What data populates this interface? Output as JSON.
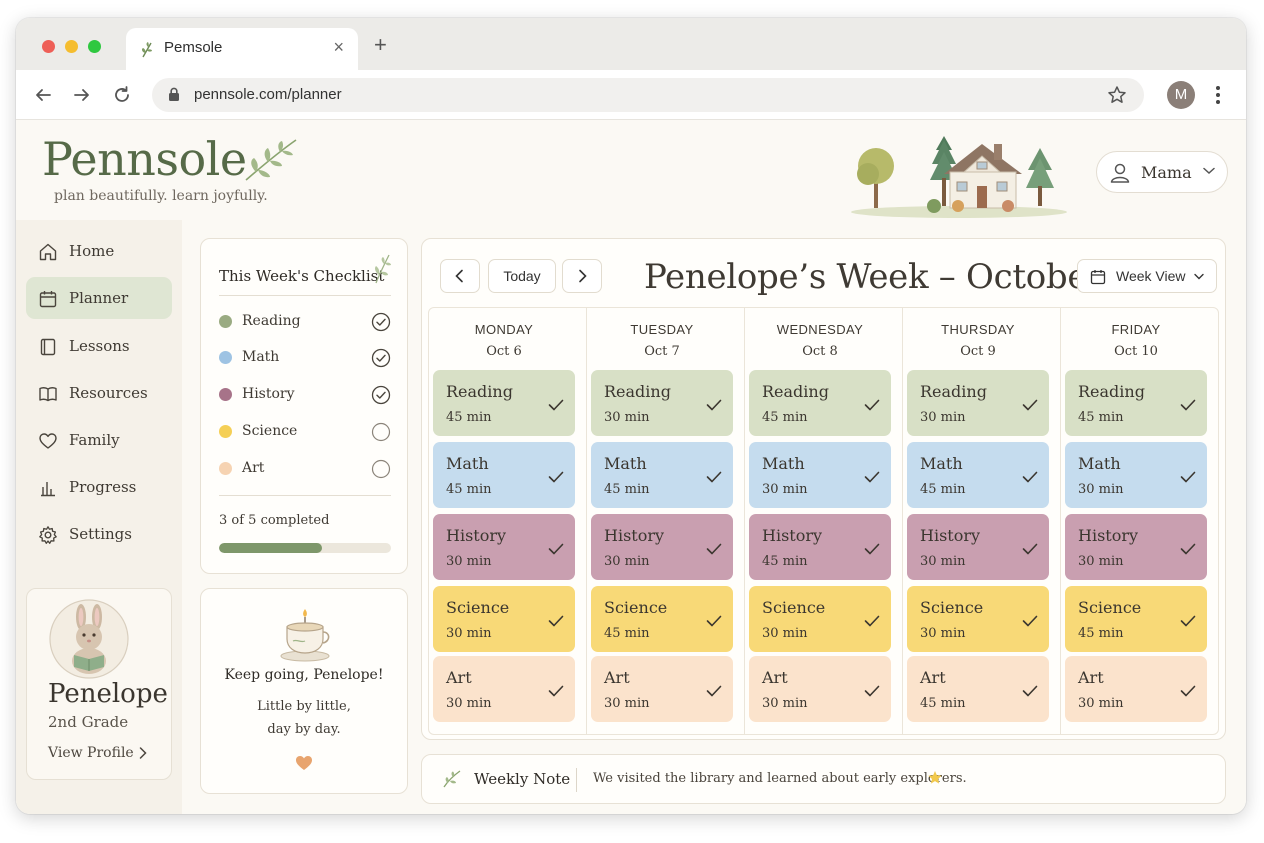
{
  "browser": {
    "tab_title": "Pemsole",
    "url": "pennsole.com/planner",
    "profile_initial": "M"
  },
  "header": {
    "brand": "Pennsole",
    "tagline": "plan beautifully. learn joyfully.",
    "user_name": "Mama"
  },
  "sidebar": {
    "items": [
      {
        "label": "Home",
        "icon": "home-icon"
      },
      {
        "label": "Planner",
        "icon": "calendar-icon",
        "active": true
      },
      {
        "label": "Lessons",
        "icon": "notebook-icon"
      },
      {
        "label": "Resources",
        "icon": "book-icon"
      },
      {
        "label": "Family",
        "icon": "heart-icon"
      },
      {
        "label": "Progress",
        "icon": "bar-chart-icon"
      },
      {
        "label": "Settings",
        "icon": "gear-icon"
      }
    ],
    "profile": {
      "name": "Penelope",
      "grade": "2nd Grade",
      "link": "View Profile"
    }
  },
  "checklist": {
    "title": "This Week's Checklist",
    "items": [
      {
        "label": "Reading",
        "color": "#9aab82",
        "done": true
      },
      {
        "label": "Math",
        "color": "#9ec3e3",
        "done": true
      },
      {
        "label": "History",
        "color": "#a77389",
        "done": true
      },
      {
        "label": "Science",
        "color": "#f5cf55",
        "done": false
      },
      {
        "label": "Art",
        "color": "#f6d3b2",
        "done": false
      }
    ],
    "status": "3 of 5 completed",
    "progress": 0.6
  },
  "encouragement": {
    "heading": "Keep going, Penelope!",
    "line1": "Little by little,",
    "line2": "day by day."
  },
  "calendar": {
    "today_label": "Today",
    "title": "Penelope’s Week – October",
    "view_label": "Week View",
    "subject_colors": {
      "Reading": "#d8e0c6",
      "Math": "#c5dcee",
      "History": "#c99fb0",
      "Science": "#f8d977",
      "Art": "#fbe3cc"
    },
    "days": [
      {
        "name": "MONDAY",
        "date": "Oct 6",
        "lessons": [
          {
            "subject": "Reading",
            "duration": "45 min"
          },
          {
            "subject": "Math",
            "duration": "45 min"
          },
          {
            "subject": "History",
            "duration": "30 min"
          },
          {
            "subject": "Science",
            "duration": "30 min"
          },
          {
            "subject": "Art",
            "duration": "30 min"
          }
        ]
      },
      {
        "name": "TUESDAY",
        "date": "Oct 7",
        "lessons": [
          {
            "subject": "Reading",
            "duration": "30 min"
          },
          {
            "subject": "Math",
            "duration": "45 min"
          },
          {
            "subject": "History",
            "duration": "30 min"
          },
          {
            "subject": "Science",
            "duration": "45 min"
          },
          {
            "subject": "Art",
            "duration": "30 min"
          }
        ]
      },
      {
        "name": "WEDNESDAY",
        "date": "Oct 8",
        "lessons": [
          {
            "subject": "Reading",
            "duration": "45 min"
          },
          {
            "subject": "Math",
            "duration": "30 min"
          },
          {
            "subject": "History",
            "duration": "45 min"
          },
          {
            "subject": "Science",
            "duration": "30 min"
          },
          {
            "subject": "Art",
            "duration": "30 min"
          }
        ]
      },
      {
        "name": "THURSDAY",
        "date": "Oct 9",
        "lessons": [
          {
            "subject": "Reading",
            "duration": "30 min"
          },
          {
            "subject": "Math",
            "duration": "45 min"
          },
          {
            "subject": "History",
            "duration": "30 min"
          },
          {
            "subject": "Science",
            "duration": "30 min"
          },
          {
            "subject": "Art",
            "duration": "45 min"
          }
        ]
      },
      {
        "name": "FRIDAY",
        "date": "Oct 10",
        "lessons": [
          {
            "subject": "Reading",
            "duration": "45 min"
          },
          {
            "subject": "Math",
            "duration": "30 min"
          },
          {
            "subject": "History",
            "duration": "30 min"
          },
          {
            "subject": "Science",
            "duration": "45 min"
          },
          {
            "subject": "Art",
            "duration": "30 min"
          }
        ]
      }
    ]
  },
  "weekly_note": {
    "label": "Weekly Note",
    "text": "We visited the library and learned about early explorers."
  }
}
